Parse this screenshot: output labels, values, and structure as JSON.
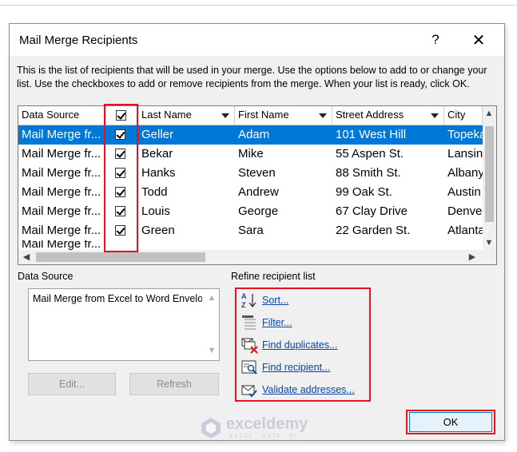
{
  "dialog": {
    "title": "Mail Merge Recipients",
    "help_label": "?",
    "close_label": "✕",
    "description": "This is the list of recipients that will be used in your merge.  Use the options below to add to or change your list.  Use the checkboxes to add or remove recipients from the merge.  When your list is ready, click OK."
  },
  "grid": {
    "columns": [
      "Data Source",
      "",
      "Last Name",
      "First Name",
      "Street Address",
      "City"
    ],
    "rows": [
      {
        "source": "Mail Merge fr...",
        "checked": true,
        "last": "Geller",
        "first": "Adam",
        "street": "101 West Hill",
        "city": "Topeka",
        "selected": true
      },
      {
        "source": "Mail Merge fr...",
        "checked": true,
        "last": "Bekar",
        "first": "Mike",
        "street": "55 Aspen St.",
        "city": "Lansing",
        "selected": false
      },
      {
        "source": "Mail Merge fr...",
        "checked": true,
        "last": "Hanks",
        "first": "Steven",
        "street": "88 Smith St.",
        "city": "Albany",
        "selected": false
      },
      {
        "source": "Mail Merge fr...",
        "checked": true,
        "last": "Todd",
        "first": "Andrew",
        "street": "99 Oak St.",
        "city": "Austin",
        "selected": false
      },
      {
        "source": "Mail Merge fr...",
        "checked": true,
        "last": "Louis",
        "first": "George",
        "street": "67 Clay Drive",
        "city": "Denver",
        "selected": false
      },
      {
        "source": "Mail Merge fr...",
        "checked": true,
        "last": "Green",
        "first": "Sara",
        "street": "22 Garden St.",
        "city": "Atlanta",
        "selected": false
      }
    ]
  },
  "data_source": {
    "label": "Data Source",
    "item": "Mail Merge from Excel to Word Envelopes",
    "edit_label": "Edit...",
    "refresh_label": "Refresh"
  },
  "refine": {
    "label": "Refine recipient list",
    "links": [
      {
        "label": "Sort...",
        "icon": "sort-az-icon"
      },
      {
        "label": "Filter...",
        "icon": "filter-icon"
      },
      {
        "label": "Find duplicates...",
        "icon": "find-duplicates-icon"
      },
      {
        "label": "Find recipient...",
        "icon": "find-recipient-icon"
      },
      {
        "label": "Validate addresses...",
        "icon": "validate-addresses-icon"
      }
    ]
  },
  "ok_label": "OK",
  "watermark": {
    "name": "exceldemy",
    "tagline": "EXCEL · DATA · BI"
  },
  "colors": {
    "selection": "#0078d7",
    "highlight": "#e8101c",
    "link": "#0645ad"
  }
}
